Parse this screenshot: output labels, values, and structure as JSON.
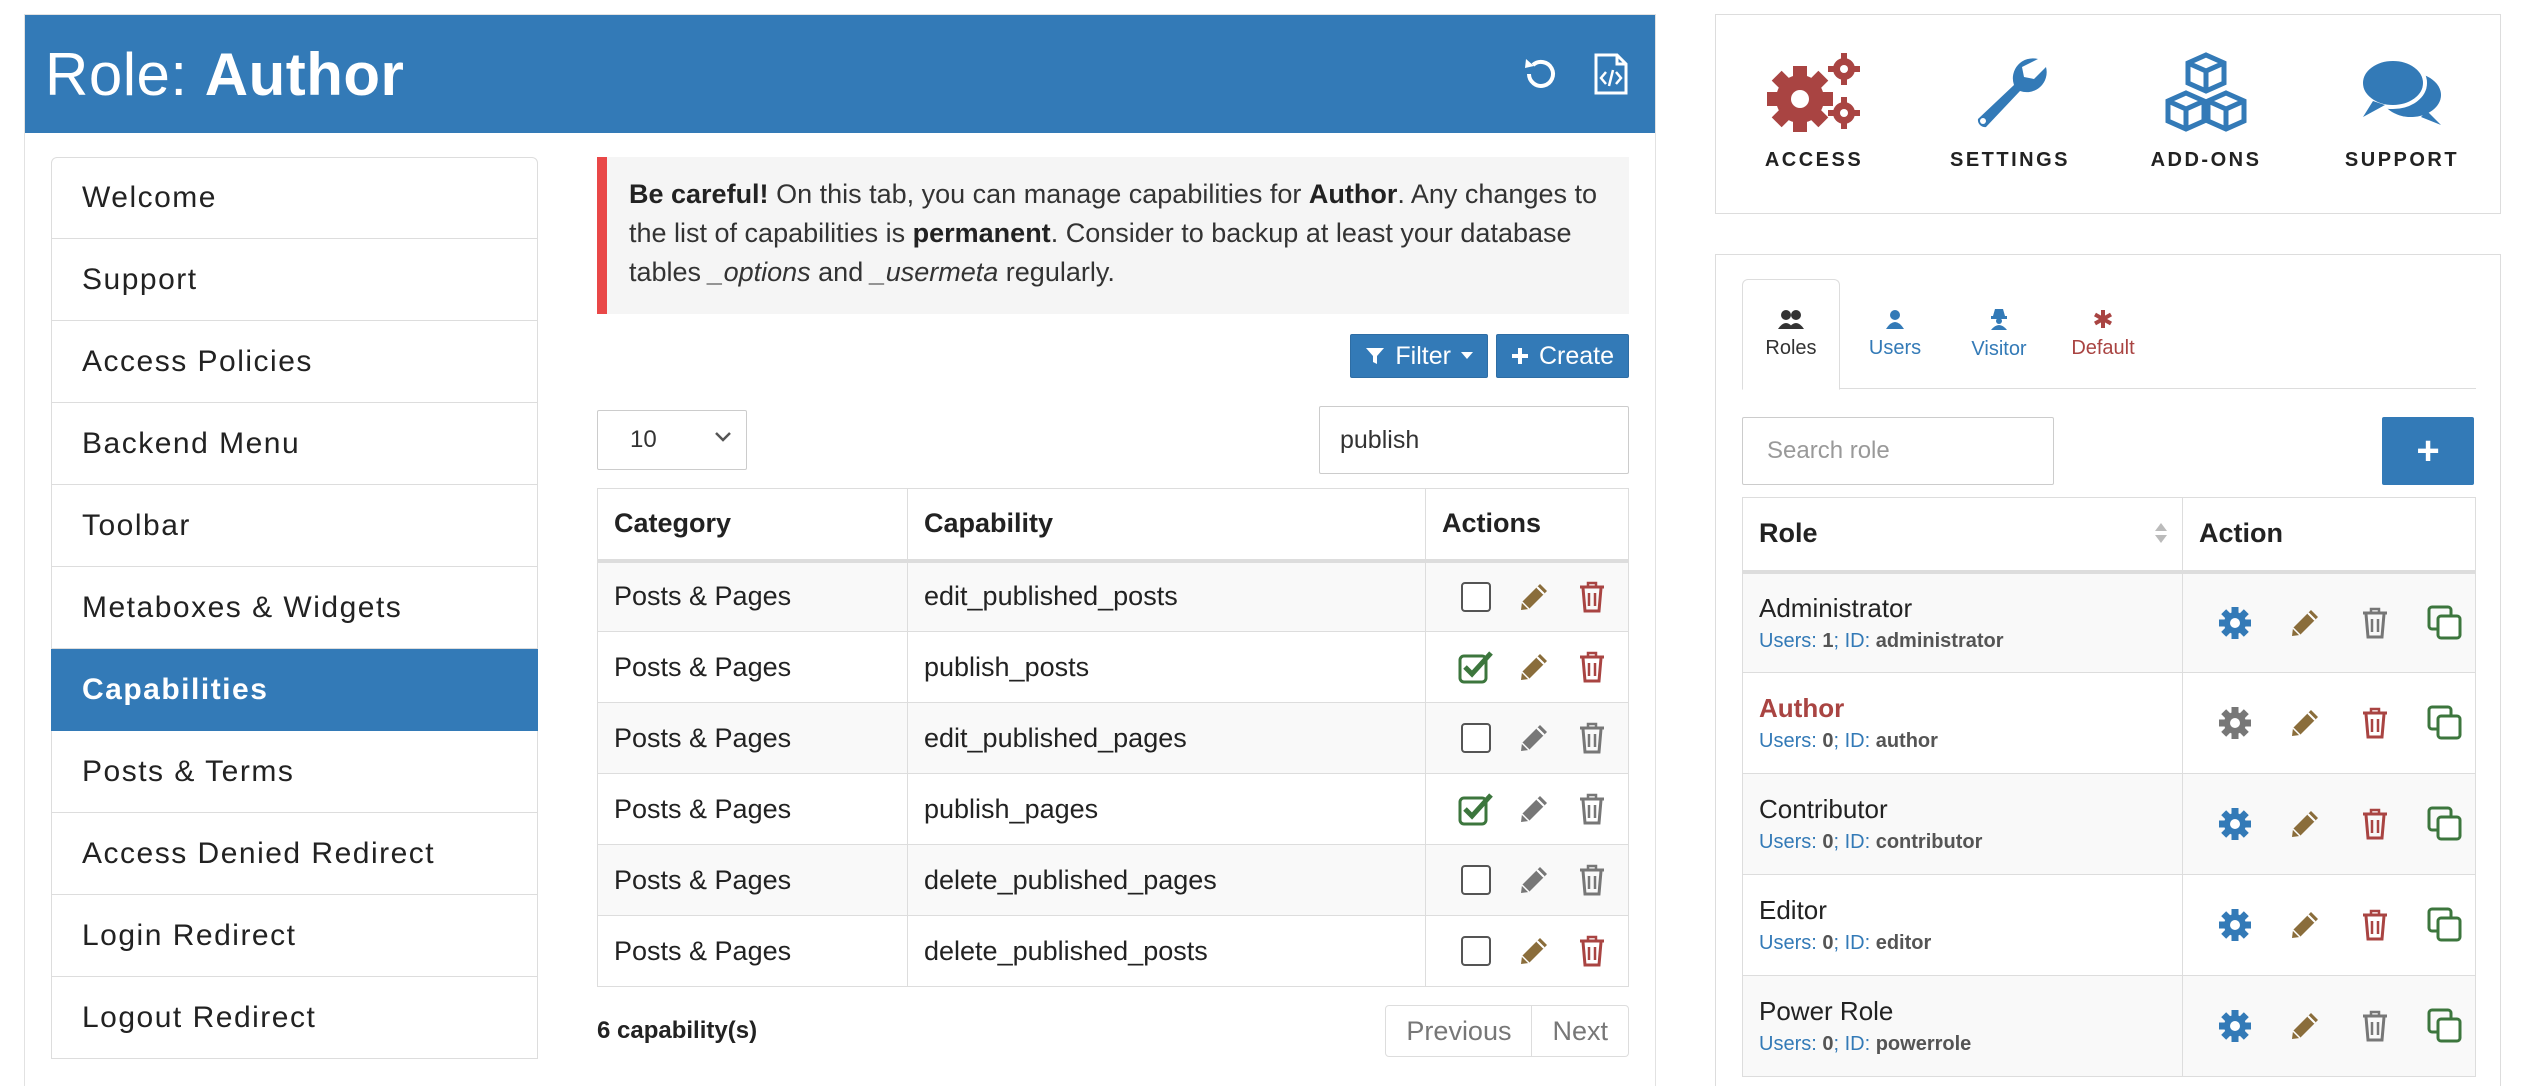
{
  "header": {
    "title_prefix": "Role: ",
    "title_role": "Author"
  },
  "sidebar": {
    "items": [
      {
        "label": "Welcome"
      },
      {
        "label": "Support"
      },
      {
        "label": "Access Policies"
      },
      {
        "label": "Backend Menu"
      },
      {
        "label": "Toolbar"
      },
      {
        "label": "Metaboxes & Widgets"
      },
      {
        "label": "Capabilities"
      },
      {
        "label": "Posts & Terms"
      },
      {
        "label": "Access Denied Redirect"
      },
      {
        "label": "Login Redirect"
      },
      {
        "label": "Logout Redirect"
      }
    ],
    "active": "Capabilities"
  },
  "alert": {
    "strong": "Be careful!",
    "t1": " On this tab, you can manage capabilities for ",
    "role": "Author",
    "t2": ". Any changes to the list of capabilities is ",
    "permanent": "permanent",
    "t3": ". Consider to backup at least your database tables ",
    "opt": "_options",
    "and": " and ",
    "usermeta": "_usermeta",
    "t4": " regularly."
  },
  "buttons": {
    "filter": "Filter",
    "create": "Create"
  },
  "page_size": "10",
  "search_value": "publish",
  "table": {
    "headers": [
      "Category",
      "Capability",
      "Actions"
    ],
    "rows": [
      {
        "category": "Posts & Pages",
        "capability": "edit_published_posts",
        "checked": false,
        "editable": true
      },
      {
        "category": "Posts & Pages",
        "capability": "publish_posts",
        "checked": true,
        "editable": true
      },
      {
        "category": "Posts & Pages",
        "capability": "edit_published_pages",
        "checked": false,
        "editable": false
      },
      {
        "category": "Posts & Pages",
        "capability": "publish_pages",
        "checked": true,
        "editable": false
      },
      {
        "category": "Posts & Pages",
        "capability": "delete_published_pages",
        "checked": false,
        "editable": false
      },
      {
        "category": "Posts & Pages",
        "capability": "delete_published_posts",
        "checked": false,
        "editable": true
      }
    ],
    "count_text": "6 capability(s)",
    "prev": "Previous",
    "next": "Next"
  },
  "tools": [
    {
      "label": "ACCESS",
      "icon": "cogs-icon"
    },
    {
      "label": "SETTINGS",
      "icon": "wrench-icon"
    },
    {
      "label": "ADD-ONS",
      "icon": "cubes-icon"
    },
    {
      "label": "SUPPORT",
      "icon": "comments-icon"
    }
  ],
  "role_tabs": [
    {
      "label": "Roles",
      "icon": "users-icon"
    },
    {
      "label": "Users",
      "icon": "user-icon"
    },
    {
      "label": "Visitor",
      "icon": "user-secret-icon"
    },
    {
      "label": "Default",
      "icon": "asterisk-icon"
    }
  ],
  "role_search_placeholder": "Search role",
  "roles_table": {
    "headers": [
      "Role",
      "Action"
    ],
    "rows": [
      {
        "name": "Administrator",
        "users_label": "Users: ",
        "users": "1",
        "id_label": "; ID: ",
        "id": "administrator",
        "current": false,
        "deletable": false
      },
      {
        "name": "Author",
        "users_label": "Users: ",
        "users": "0",
        "id_label": "; ID: ",
        "id": "author",
        "current": true,
        "deletable": true
      },
      {
        "name": "Contributor",
        "users_label": "Users: ",
        "users": "0",
        "id_label": "; ID: ",
        "id": "contributor",
        "current": false,
        "deletable": true
      },
      {
        "name": "Editor",
        "users_label": "Users: ",
        "users": "0",
        "id_label": "; ID: ",
        "id": "editor",
        "current": false,
        "deletable": true
      },
      {
        "name": "Power Role",
        "users_label": "Users: ",
        "users": "0",
        "id_label": "; ID: ",
        "id": "powerrole",
        "current": false,
        "deletable": false
      }
    ]
  },
  "colors": {
    "primary": "#337ab7",
    "danger": "#a94442",
    "alert_border": "#e94848",
    "edit": "#8a6d3b",
    "success": "#3c763d",
    "muted": "#777777"
  }
}
